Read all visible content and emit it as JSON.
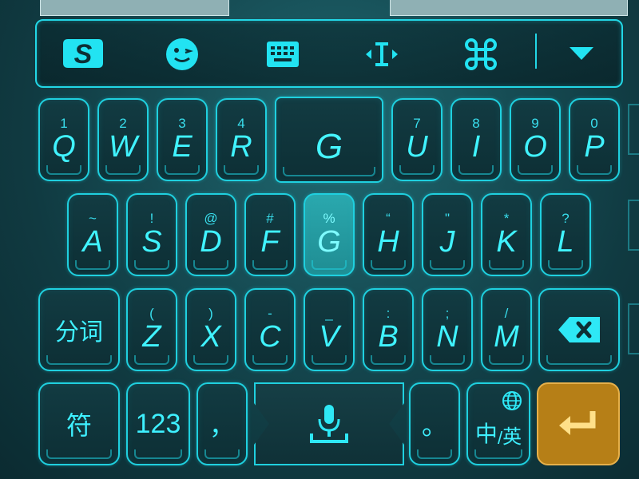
{
  "toolbar": {
    "icons": [
      "sogou-logo-icon",
      "emoji-icon",
      "keyboard-icon",
      "cursor-icon",
      "command-icon",
      "collapse-icon"
    ]
  },
  "rows": [
    [
      {
        "sub": "1",
        "main": "Q"
      },
      {
        "sub": "2",
        "main": "W"
      },
      {
        "sub": "3",
        "main": "E"
      },
      {
        "sub": "4",
        "main": "R"
      },
      {
        "sub": "",
        "main": "G",
        "big": true
      },
      {
        "sub": "7",
        "main": "U"
      },
      {
        "sub": "8",
        "main": "I"
      },
      {
        "sub": "9",
        "main": "O"
      },
      {
        "sub": "0",
        "main": "P"
      }
    ],
    [
      {
        "sub": "~",
        "main": "A"
      },
      {
        "sub": "!",
        "main": "S"
      },
      {
        "sub": "@",
        "main": "D"
      },
      {
        "sub": "#",
        "main": "F"
      },
      {
        "sub": "%",
        "main": "G",
        "lit": true
      },
      {
        "sub": "“",
        "main": "H"
      },
      {
        "sub": "\"",
        "main": "J"
      },
      {
        "sub": "*",
        "main": "K"
      },
      {
        "sub": "?",
        "main": "L"
      }
    ],
    [
      {
        "sub": "(",
        "main": "Z"
      },
      {
        "sub": ")",
        "main": "X"
      },
      {
        "sub": "-",
        "main": "C"
      },
      {
        "sub": "_",
        "main": "V"
      },
      {
        "sub": ":",
        "main": "B"
      },
      {
        "sub": ";",
        "main": "N"
      },
      {
        "sub": "/",
        "main": "M"
      }
    ]
  ],
  "function_keys": {
    "segment": "分词",
    "symbols": "符",
    "numbers": "123",
    "comma": "，",
    "period": "。",
    "lang_cn": "中",
    "lang_sep": "/",
    "lang_en": "英"
  },
  "colors": {
    "accent": "#1fd0df",
    "enter": "#b67f17"
  }
}
